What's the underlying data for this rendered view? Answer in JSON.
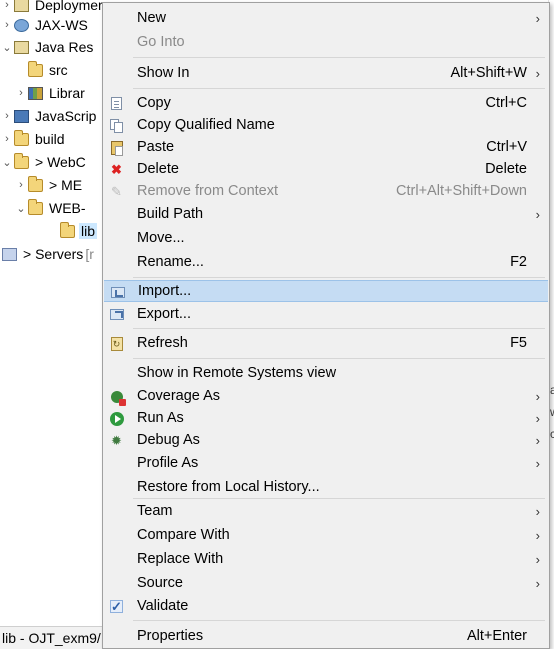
{
  "tree": {
    "items": [
      {
        "label": "Deploymer",
        "dim": ""
      },
      {
        "label": "JAX-WS",
        "dim": ""
      },
      {
        "label": "Java Res",
        "dim": ""
      },
      {
        "label": "src",
        "dim": ""
      },
      {
        "label": "Librar",
        "dim": ""
      },
      {
        "label": "JavaScrip",
        "dim": ""
      },
      {
        "label": "build",
        "dim": ""
      },
      {
        "label": "> WebC",
        "dim": ""
      },
      {
        "label": "> ME",
        "dim": ""
      },
      {
        "label": "WEB-",
        "dim": ""
      },
      {
        "label": "lib",
        "dim": ""
      },
      {
        "label": "> Servers",
        "dim": " [r"
      }
    ]
  },
  "status_tab": "lib - OJT_exm9/",
  "menu": {
    "new": {
      "label": "New"
    },
    "go_into": {
      "label": "Go Into"
    },
    "show_in": {
      "label": "Show In",
      "shortcut": "Alt+Shift+W"
    },
    "copy": {
      "label": "Copy",
      "shortcut": "Ctrl+C"
    },
    "copy_qualified_name": {
      "label": "Copy Qualified Name"
    },
    "paste": {
      "label": "Paste",
      "shortcut": "Ctrl+V"
    },
    "delete": {
      "label": "Delete",
      "shortcut": "Delete"
    },
    "remove_from_context": {
      "label": "Remove from Context",
      "shortcut": "Ctrl+Alt+Shift+Down"
    },
    "build_path": {
      "label": "Build Path"
    },
    "move": {
      "label": "Move..."
    },
    "rename": {
      "label": "Rename...",
      "shortcut": "F2"
    },
    "import": {
      "label": "Import..."
    },
    "export": {
      "label": "Export..."
    },
    "refresh": {
      "label": "Refresh",
      "shortcut": "F5"
    },
    "show_in_remote": {
      "label": "Show in Remote Systems view"
    },
    "coverage_as": {
      "label": "Coverage As"
    },
    "run_as": {
      "label": "Run As"
    },
    "debug_as": {
      "label": "Debug As"
    },
    "profile_as": {
      "label": "Profile As"
    },
    "restore_local_history": {
      "label": "Restore from Local History..."
    },
    "team": {
      "label": "Team"
    },
    "compare_with": {
      "label": "Compare With"
    },
    "replace_with": {
      "label": "Replace With"
    },
    "source": {
      "label": "Source"
    },
    "validate": {
      "label": "Validate"
    },
    "properties": {
      "label": "Properties",
      "shortcut": "Alt+Enter"
    },
    "submenu_glyph": "›"
  },
  "right_edge": {
    "glyphs": [
      "a",
      "w",
      "c"
    ]
  },
  "colors": {
    "highlight": "#c5dcf3",
    "menu_bg": "#f0f0f0",
    "disabled": "#8a8a8a"
  }
}
